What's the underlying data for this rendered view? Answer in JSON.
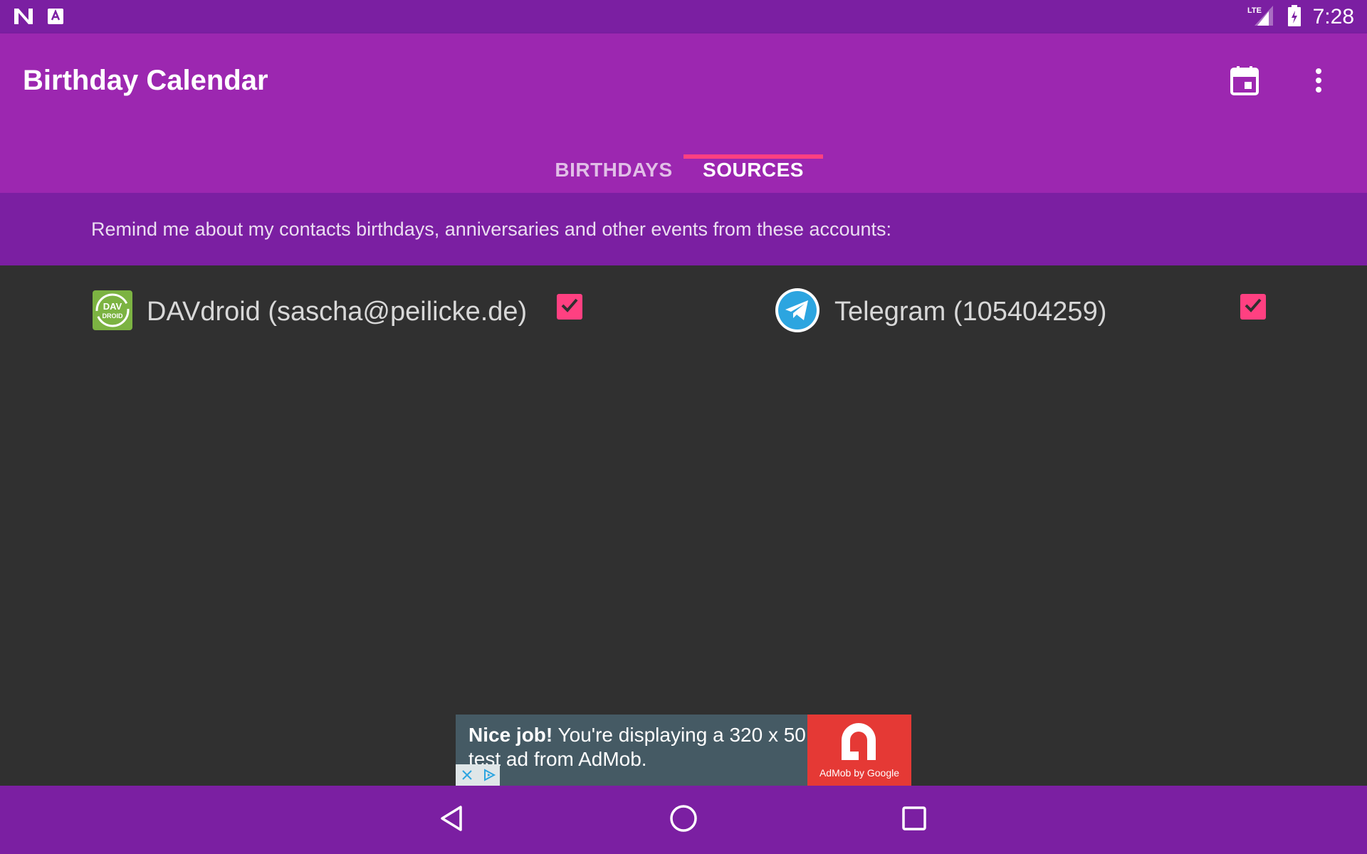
{
  "status_bar": {
    "time": "7:28",
    "network": "LTE",
    "icons": [
      "n-logo-icon",
      "a-notification-icon",
      "signal-icon",
      "battery-icon"
    ]
  },
  "app_bar": {
    "title": "Birthday Calendar",
    "actions": [
      "calendar-icon",
      "more-options-icon"
    ]
  },
  "tabs": [
    {
      "label": "BIRTHDAYS",
      "selected": false
    },
    {
      "label": "SOURCES",
      "selected": true
    }
  ],
  "info": {
    "text": "Remind me about my contacts birthdays, anniversaries and other events from these accounts:"
  },
  "sources": [
    {
      "label": "DAVdroid (sascha@peilicke.de)",
      "icon": "davdroid-icon",
      "icon_text_top": "DAV",
      "icon_text_bottom": "DROID",
      "checked": true
    },
    {
      "label": "Telegram (105404259)",
      "icon": "telegram-icon",
      "checked": true
    }
  ],
  "ad": {
    "headline": "Nice job!",
    "body": "You're displaying a 320 x 50 test ad from AdMob.",
    "brand": "AdMob by Google"
  },
  "colors": {
    "primary": "#9c27b0",
    "primary_dark": "#7b1fa2",
    "accent": "#ff4081",
    "background": "#303030"
  }
}
